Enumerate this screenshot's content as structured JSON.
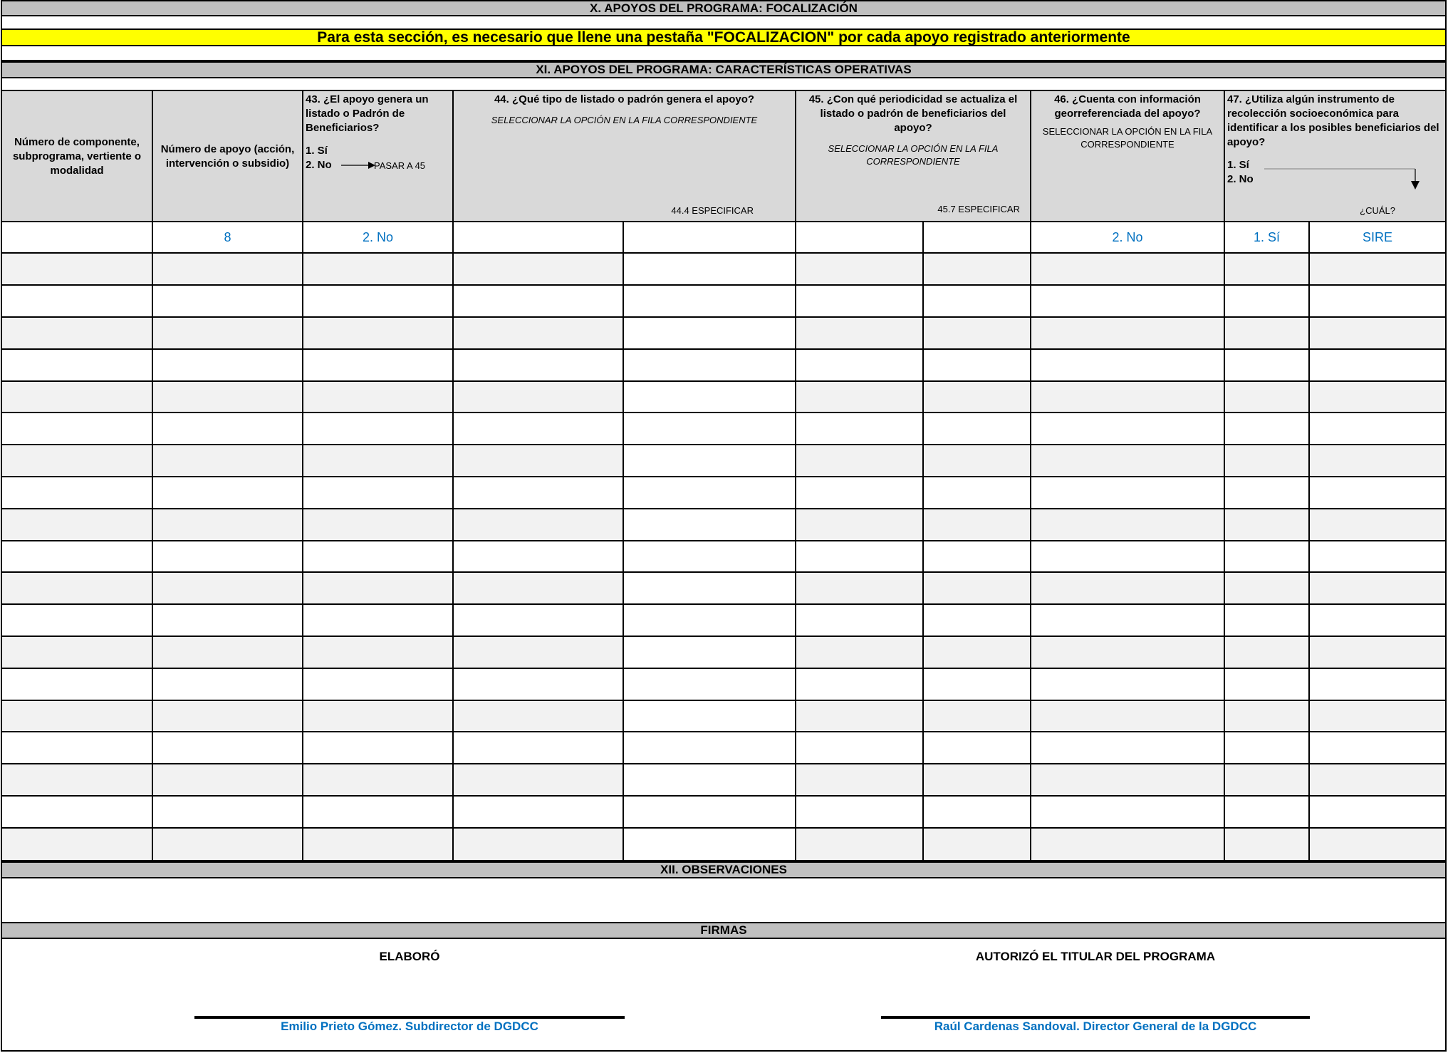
{
  "sections": {
    "x_title": "X. APOYOS DEL PROGRAMA: FOCALIZACIÓN",
    "notice": "Para esta sección, es necesario que llene una pestaña \"FOCALIZACION\" por cada apoyo registrado anteriormente",
    "xi_title": "XI. APOYOS DEL PROGRAMA: CARACTERÍSTICAS OPERATIVAS",
    "xii_title": "XII. OBSERVACIONES",
    "firmas_title": "FIRMAS"
  },
  "headers": {
    "componente": "Número de componente, subprograma, vertiente o modalidad",
    "apoyo": "Número de apoyo (acción, intervención o subsidio)",
    "q43": {
      "question": "43. ¿El apoyo genera un listado o Padrón de Beneficiarios?",
      "opt1": "1. Sí",
      "opt2": "2. No",
      "jump": "PASAR A 45"
    },
    "q44": {
      "question": "44. ¿Qué tipo de listado o padrón genera el apoyo?",
      "instruction": "SELECCIONAR LA OPCIÓN EN LA FILA CORRESPONDIENTE",
      "specify": "44.4 ESPECIFICAR"
    },
    "q45": {
      "question": "45. ¿Con qué periodicidad se actualiza el listado o padrón de beneficiarios del apoyo?",
      "instruction": "SELECCIONAR LA OPCIÓN EN LA FILA CORRESPONDIENTE",
      "specify": "45.7 ESPECIFICAR"
    },
    "q46": {
      "question": "46. ¿Cuenta con información georreferenciada del apoyo?",
      "instruction": "SELECCIONAR LA OPCIÓN EN LA FILA CORRESPONDIENTE"
    },
    "q47": {
      "question": "47. ¿Utiliza algún instrumento de recolección socioeconómica para identificar a los posibles beneficiarios del apoyo?",
      "opt1": "1. Sí",
      "opt2": "2. No",
      "which": "¿CUÁL?"
    }
  },
  "rows": [
    [
      "",
      "8",
      "2. No",
      "",
      "",
      "",
      "",
      "2. No",
      "1. Sí",
      "SIRE"
    ],
    [
      "",
      "",
      "",
      "",
      "",
      "",
      "",
      "",
      "",
      ""
    ],
    [
      "",
      "",
      "",
      "",
      "",
      "",
      "",
      "",
      "",
      ""
    ],
    [
      "",
      "",
      "",
      "",
      "",
      "",
      "",
      "",
      "",
      ""
    ],
    [
      "",
      "",
      "",
      "",
      "",
      "",
      "",
      "",
      "",
      ""
    ],
    [
      "",
      "",
      "",
      "",
      "",
      "",
      "",
      "",
      "",
      ""
    ],
    [
      "",
      "",
      "",
      "",
      "",
      "",
      "",
      "",
      "",
      ""
    ],
    [
      "",
      "",
      "",
      "",
      "",
      "",
      "",
      "",
      "",
      ""
    ],
    [
      "",
      "",
      "",
      "",
      "",
      "",
      "",
      "",
      "",
      ""
    ],
    [
      "",
      "",
      "",
      "",
      "",
      "",
      "",
      "",
      "",
      ""
    ],
    [
      "",
      "",
      "",
      "",
      "",
      "",
      "",
      "",
      "",
      ""
    ],
    [
      "",
      "",
      "",
      "",
      "",
      "",
      "",
      "",
      "",
      ""
    ],
    [
      "",
      "",
      "",
      "",
      "",
      "",
      "",
      "",
      "",
      ""
    ],
    [
      "",
      "",
      "",
      "",
      "",
      "",
      "",
      "",
      "",
      ""
    ],
    [
      "",
      "",
      "",
      "",
      "",
      "",
      "",
      "",
      "",
      ""
    ],
    [
      "",
      "",
      "",
      "",
      "",
      "",
      "",
      "",
      "",
      ""
    ],
    [
      "",
      "",
      "",
      "",
      "",
      "",
      "",
      "",
      "",
      ""
    ],
    [
      "",
      "",
      "",
      "",
      "",
      "",
      "",
      "",
      "",
      ""
    ],
    [
      "",
      "",
      "",
      "",
      "",
      "",
      "",
      "",
      "",
      ""
    ],
    [
      "",
      "",
      "",
      "",
      "",
      "",
      "",
      "",
      "",
      ""
    ]
  ],
  "observaciones": "",
  "firmas": {
    "elaboro_label": "ELABORÓ",
    "elaboro_name": "Emilio Prieto Gómez. Subdirector de DGDCC",
    "autorizo_label": "AUTORIZÓ EL TITULAR DEL PROGRAMA",
    "autorizo_name": "Raúl Cardenas Sandoval. Director General de la DGDCC"
  },
  "colors": {
    "band_gray": "#c0c0c0",
    "header_gray": "#d9d9d9",
    "row_alt": "#f2f2f2",
    "notice_yellow": "#ffff00",
    "value_blue": "#0070c0"
  }
}
